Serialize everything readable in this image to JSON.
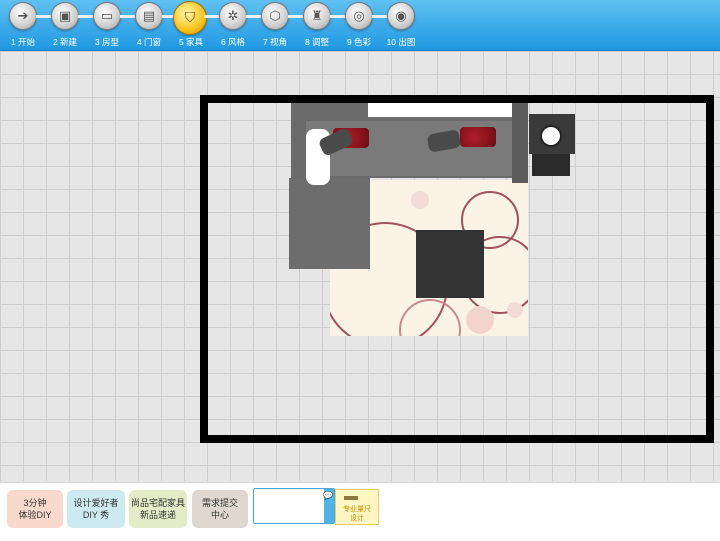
{
  "toolbar": {
    "steps": [
      {
        "label": "1 开始",
        "icon": "arrow-right-icon",
        "glyph": "➔"
      },
      {
        "label": "2 新建",
        "icon": "folder-icon",
        "glyph": "▣"
      },
      {
        "label": "3 房型",
        "icon": "floorplan-icon",
        "glyph": "▭"
      },
      {
        "label": "4 门窗",
        "icon": "door-window-icon",
        "glyph": "▤"
      },
      {
        "label": "5 家具",
        "icon": "furniture-icon",
        "glyph": "⛉"
      },
      {
        "label": "6 风格",
        "icon": "style-icon",
        "glyph": "✲"
      },
      {
        "label": "7 视角",
        "icon": "cube-view-icon",
        "glyph": "⬡"
      },
      {
        "label": "8 调整",
        "icon": "chair-icon",
        "glyph": "♜"
      },
      {
        "label": "9 色彩",
        "icon": "color-swirl-icon",
        "glyph": "◎"
      },
      {
        "label": "10 出图",
        "icon": "camera-icon",
        "glyph": "◉"
      }
    ],
    "active_step": 4
  },
  "bottom": {
    "btn1": {
      "line1": "3分钟",
      "line2": "体验DIY",
      "color": "#f9d9cc"
    },
    "btn2": {
      "line1": "设计爱好者",
      "line2": "DIY 秀",
      "color": "#cdeaf0"
    },
    "btn3": {
      "line1": "尚品宅配家具",
      "line2": "新品速递",
      "color": "#e3ecc6"
    },
    "btn4": {
      "line1": "需求提交",
      "line2": "中心",
      "color": "#e0d8ce"
    },
    "chat_icon": "chat-bubble-icon",
    "ruler": {
      "line1": "专业量尺",
      "line2": "设计"
    }
  },
  "colors": {
    "accent": "#1f98e2",
    "active_step": "#f7c31a",
    "wall": "#000000",
    "sofa": "#6b6b6b",
    "cushion": "#9a1420"
  }
}
